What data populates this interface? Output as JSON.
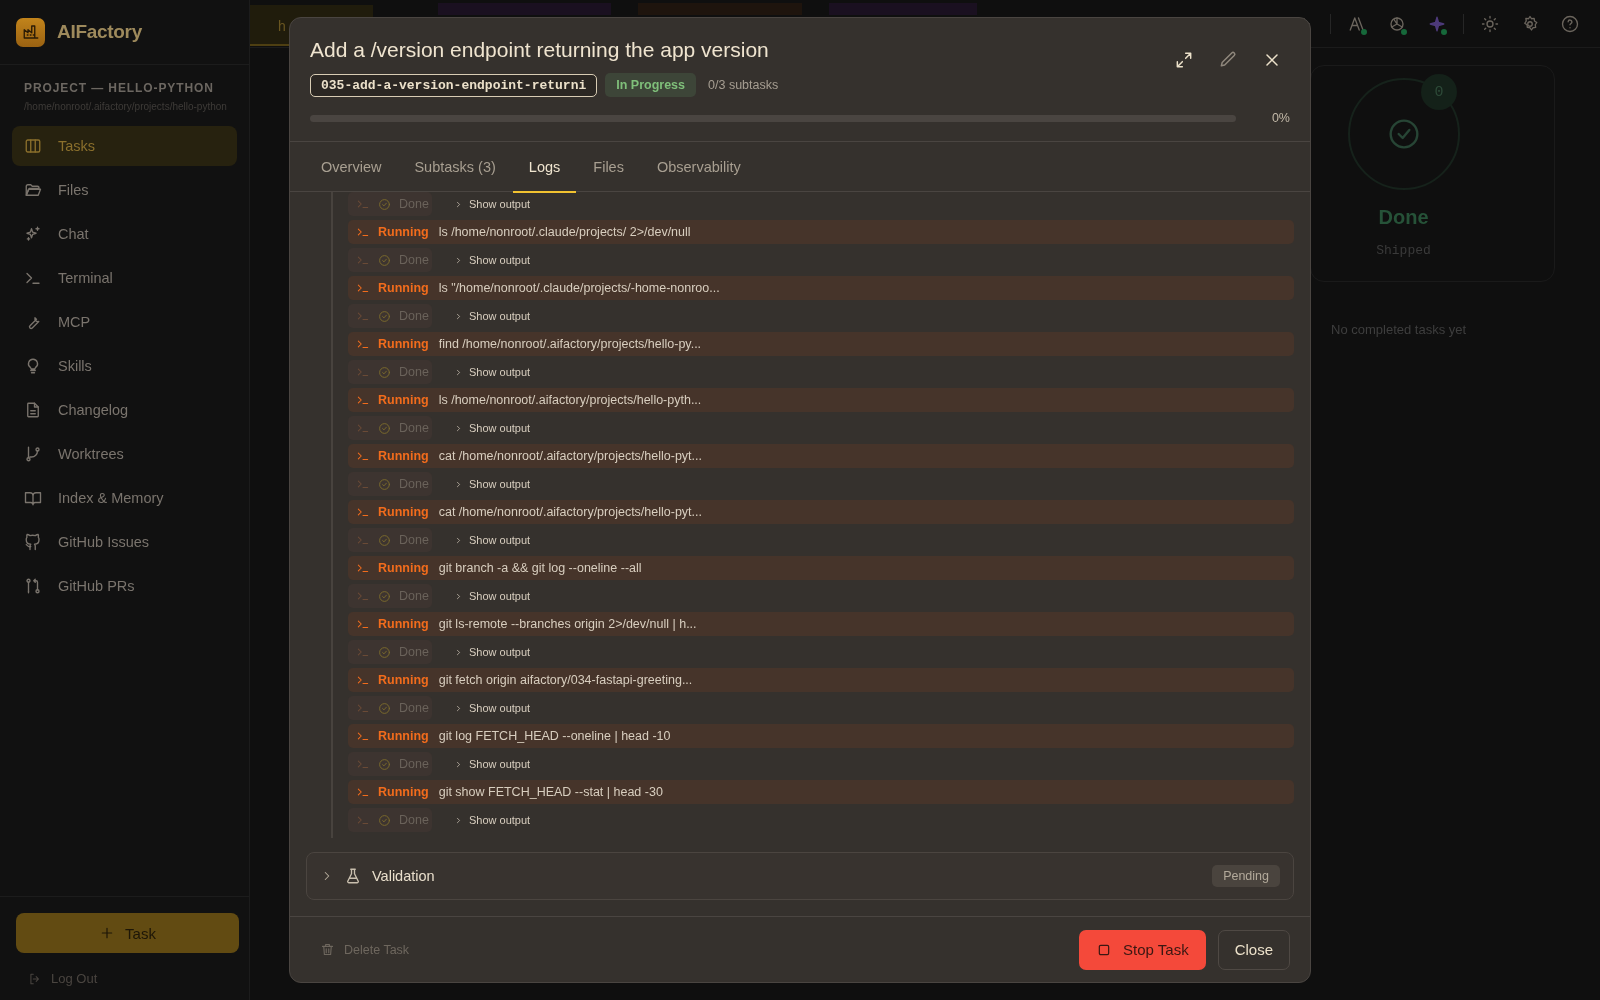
{
  "app": {
    "name": "AIFactory"
  },
  "sidebar": {
    "project_label": "PROJECT — HELLO-PYTHON",
    "project_path": "/home/nonroot/.aifactory/projects/hello-python",
    "items": [
      {
        "label": "Tasks",
        "selected": true
      },
      {
        "label": "Files",
        "selected": false
      },
      {
        "label": "Chat",
        "selected": false
      },
      {
        "label": "Terminal",
        "selected": false
      },
      {
        "label": "MCP",
        "selected": false
      },
      {
        "label": "Skills",
        "selected": false
      },
      {
        "label": "Changelog",
        "selected": false
      },
      {
        "label": "Worktrees",
        "selected": false
      },
      {
        "label": "Index & Memory",
        "selected": false
      },
      {
        "label": "GitHub Issues",
        "selected": false
      },
      {
        "label": "GitHub PRs",
        "selected": false
      }
    ],
    "new_task_button": "Task",
    "logout": "Log Out"
  },
  "topbar": {
    "tab": "h"
  },
  "board": {
    "column": {
      "count": "0",
      "title": "Done",
      "subtitle": "Shipped",
      "empty": "No completed tasks yet"
    }
  },
  "modal": {
    "title": "Add a /version endpoint returning the app version",
    "branch": "035-add-a-version-endpoint-returni",
    "status": "In Progress",
    "subtasks": "0/3 subtasks",
    "progress": {
      "level": 0,
      "reading": "0%"
    },
    "tabs": [
      {
        "label": "Overview",
        "selected": false
      },
      {
        "label": "Subtasks (3)",
        "selected": false
      },
      {
        "label": "Logs",
        "selected": true
      },
      {
        "label": "Files",
        "selected": false
      },
      {
        "label": "Observability",
        "selected": false
      }
    ],
    "logs": [
      {
        "kind": "done",
        "status": "Done",
        "action": "Show output"
      },
      {
        "kind": "running",
        "status": "Running",
        "command": "ls /home/nonroot/.claude/projects/ 2>/dev/null"
      },
      {
        "kind": "done",
        "status": "Done",
        "action": "Show output"
      },
      {
        "kind": "running",
        "status": "Running",
        "command": "ls \"/home/nonroot/.claude/projects/-home-nonroo..."
      },
      {
        "kind": "done",
        "status": "Done",
        "action": "Show output"
      },
      {
        "kind": "running",
        "status": "Running",
        "command": "find /home/nonroot/.aifactory/projects/hello-py..."
      },
      {
        "kind": "done",
        "status": "Done",
        "action": "Show output"
      },
      {
        "kind": "running",
        "status": "Running",
        "command": "ls /home/nonroot/.aifactory/projects/hello-pyth..."
      },
      {
        "kind": "done",
        "status": "Done",
        "action": "Show output"
      },
      {
        "kind": "running",
        "status": "Running",
        "command": "cat /home/nonroot/.aifactory/projects/hello-pyt..."
      },
      {
        "kind": "done",
        "status": "Done",
        "action": "Show output"
      },
      {
        "kind": "running",
        "status": "Running",
        "command": "cat /home/nonroot/.aifactory/projects/hello-pyt..."
      },
      {
        "kind": "done",
        "status": "Done",
        "action": "Show output"
      },
      {
        "kind": "running",
        "status": "Running",
        "command": "git branch -a && git log --oneline --all"
      },
      {
        "kind": "done",
        "status": "Done",
        "action": "Show output"
      },
      {
        "kind": "running",
        "status": "Running",
        "command": "git ls-remote --branches origin 2>/dev/null | h..."
      },
      {
        "kind": "done",
        "status": "Done",
        "action": "Show output"
      },
      {
        "kind": "running",
        "status": "Running",
        "command": "git fetch origin aifactory/034-fastapi-greeting..."
      },
      {
        "kind": "done",
        "status": "Done",
        "action": "Show output"
      },
      {
        "kind": "running",
        "status": "Running",
        "command": "git log FETCH_HEAD --oneline | head -10"
      },
      {
        "kind": "done",
        "status": "Done",
        "action": "Show output"
      },
      {
        "kind": "running",
        "status": "Running",
        "command": "git show FETCH_HEAD --stat | head -30"
      },
      {
        "kind": "done",
        "status": "Done",
        "action": "Show output"
      }
    ],
    "validation": {
      "title": "Validation",
      "status": "Pending",
      "expanded": false
    },
    "footer": {
      "delete": "Delete Task",
      "stop": "Stop Task",
      "close": "Close"
    }
  }
}
